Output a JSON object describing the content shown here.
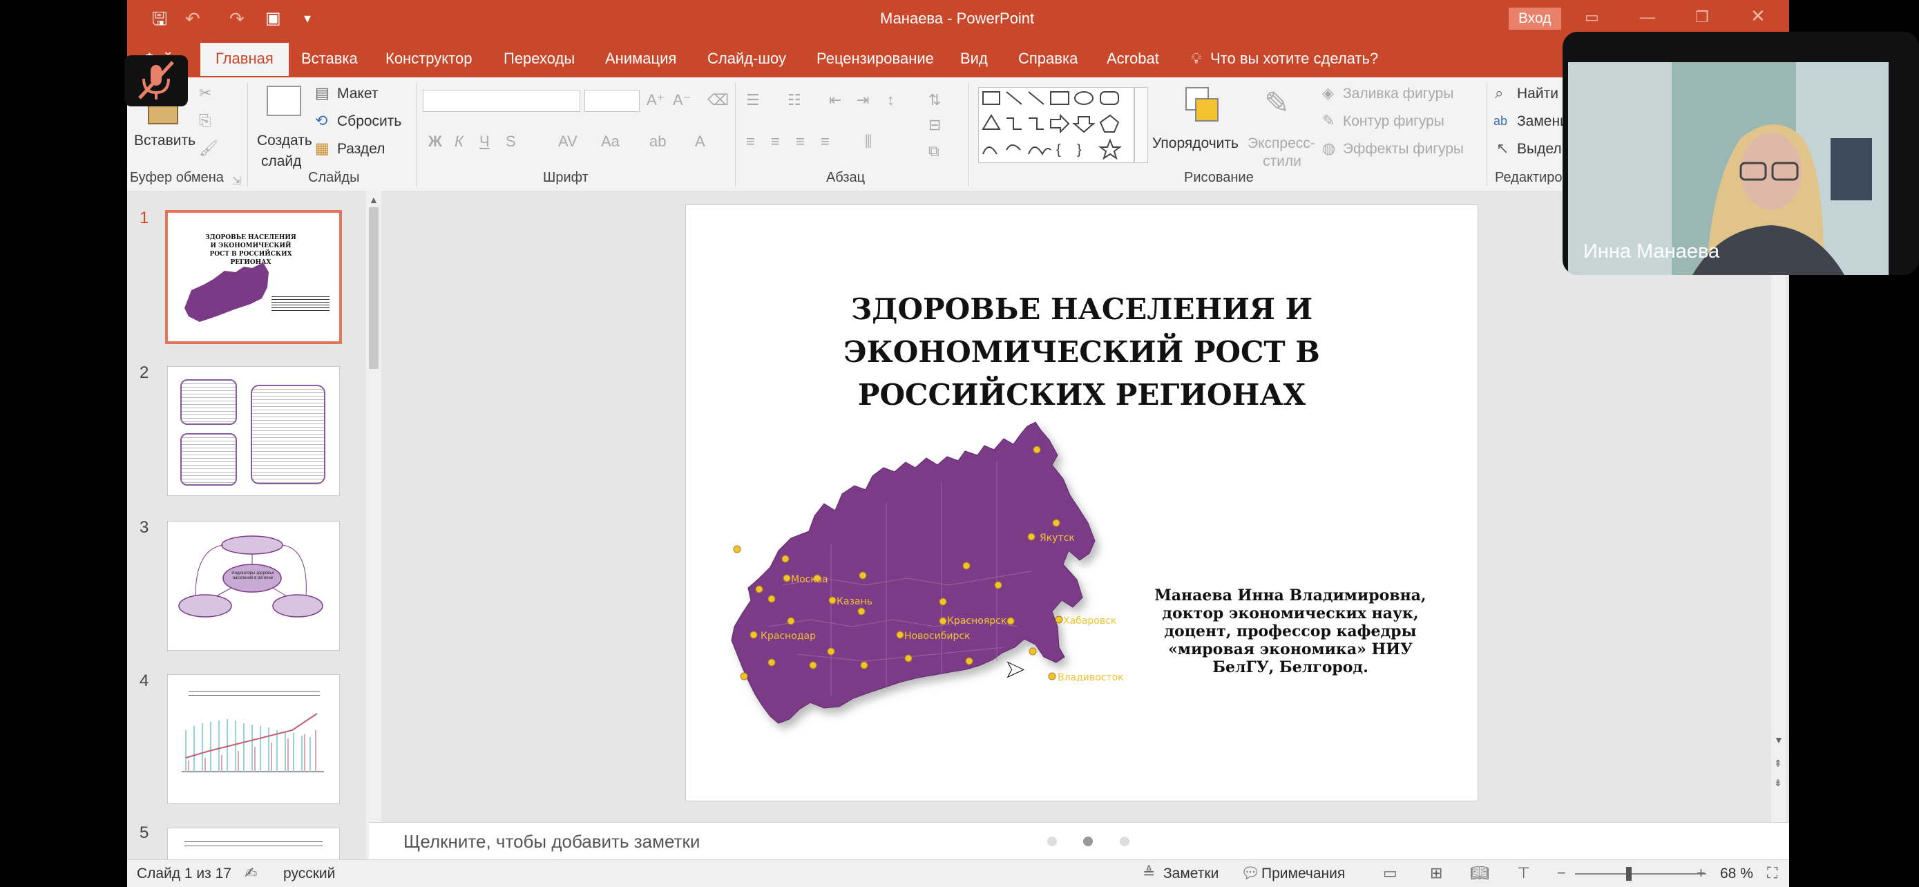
{
  "app": {
    "title": "Манаева  -  PowerPoint",
    "signin": "Вход"
  },
  "tabs": [
    "Файл",
    "Главная",
    "Вставка",
    "Конструктор",
    "Переходы",
    "Анимация",
    "Слайд-шоу",
    "Рецензирование",
    "Вид",
    "Справка",
    "Acrobat"
  ],
  "active_tab": "Главная",
  "tell_me": "Что вы хотите сделать?",
  "ribbon": {
    "paste": "Вставить",
    "clipboard_group": "Буфер обмена",
    "new_slide_1": "Создать",
    "new_slide_2": "слайд",
    "layout": "Макет",
    "reset": "Сбросить",
    "section": "Раздел",
    "slides_group": "Слайды",
    "font_group": "Шрифт",
    "paragraph_group": "Абзац",
    "arrange": "Упорядочить",
    "quick_styles_1": "Экспресс-",
    "quick_styles_2": "стили",
    "shape_fill": "Заливка фигуры",
    "shape_outline": "Контур фигуры",
    "shape_effects": "Эффекты фигуры",
    "drawing_group": "Рисование",
    "find": "Найти",
    "replace": "Замени",
    "select": "Выдели",
    "editing_group": "Редактиро"
  },
  "thumbnails": [
    {
      "num": "1",
      "title": "ЗДОРОВЬЕ НАСЕЛЕНИЯ И ЭКОНОМИЧЕСКИЙ РОСТ В РОССИЙСКИХ РЕГИОНАХ"
    },
    {
      "num": "2"
    },
    {
      "num": "3",
      "center": "Индикаторы здоровья населения в регионе"
    },
    {
      "num": "4"
    },
    {
      "num": "5"
    }
  ],
  "slide": {
    "title_1": "ЗДОРОВЬЕ НАСЕЛЕНИЯ И",
    "title_2": "ЭКОНОМИЧЕСКИЙ РОСТ В",
    "title_3": "РОССИЙСКИХ РЕГИОНАХ",
    "author_1": "Манаева Инна Владимировна,",
    "author_2": "доктор экономических наук,",
    "author_3": "доцент, профессор кафедры",
    "author_4": "«мировая экономика» НИУ",
    "author_5": "БелГУ, Белгород.",
    "cities": [
      "Якутск",
      "Москва",
      "Казань",
      "Новосибирск",
      "Краснодар",
      "Красноярск",
      "Хабаровск",
      "Владивосток"
    ]
  },
  "notes_placeholder": "Щелкните, чтобы добавить заметки",
  "status": {
    "slide_counter": "Слайд 1 из 17",
    "language": "русский",
    "notes": "Заметки",
    "comments": "Примечания",
    "zoom": "68 %"
  },
  "video": {
    "participant": "Инна Манаева"
  },
  "colors": {
    "accent": "#c9472a",
    "map": "#7b3a86",
    "city_dot": "#f2c230"
  }
}
